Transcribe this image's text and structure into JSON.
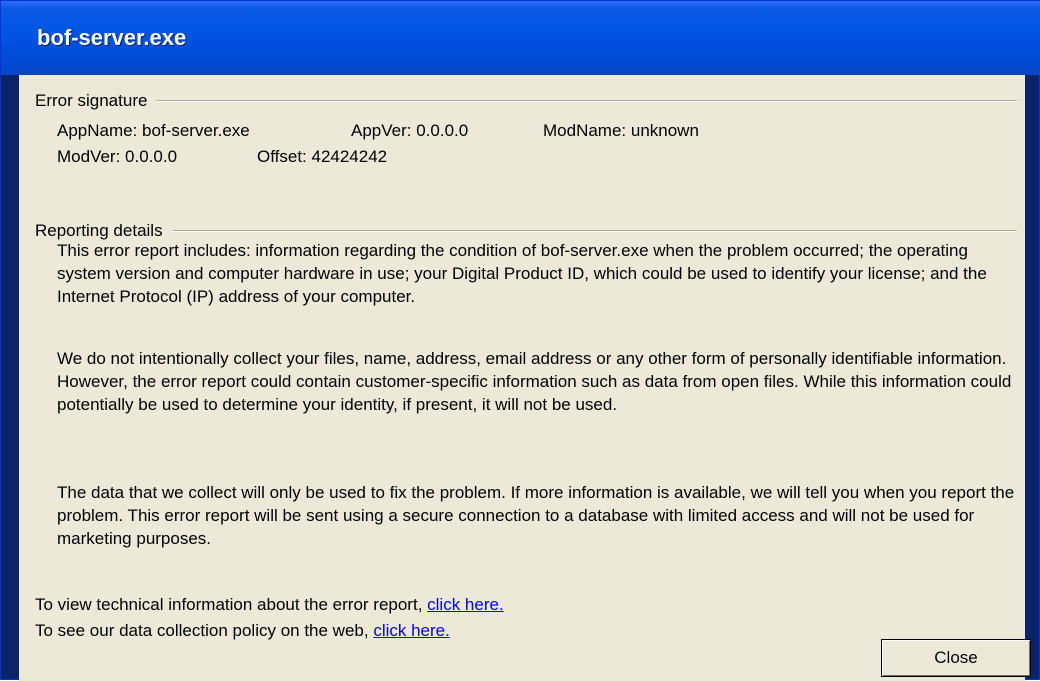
{
  "window": {
    "title": "bof-server.exe"
  },
  "error_signature": {
    "heading": "Error signature",
    "app_name": "AppName: bof-server.exe",
    "app_ver": "AppVer: 0.0.0.0",
    "mod_name": "ModName: unknown",
    "mod_ver": "ModVer: 0.0.0.0",
    "offset": "Offset: 42424242"
  },
  "reporting_details": {
    "heading": "Reporting details",
    "paragraphs": [
      "This error report includes: information regarding the condition of bof-server.exe when the problem occurred; the operating system version and computer hardware in use; your Digital Product ID, which could be used to identify your license; and the Internet Protocol (IP) address of your computer.",
      "We do not intentionally collect your files, name, address, email address or any other form of personally identifiable information. However, the error report could contain customer-specific information such as data from open files. While this information could potentially be used to determine your identity, if present, it will not be used.",
      "The data that we collect will only be used to fix the problem. If more information is available, we will tell you when you report the problem. This error report will be sent using a secure connection to a database with limited access and will not be used for marketing purposes."
    ]
  },
  "links": {
    "technical_text": "To view technical information about the error report,",
    "technical_link": "click here.",
    "policy_text": "To see our data collection policy on the web,",
    "policy_link": "click here."
  },
  "buttons": {
    "close_label": "Close"
  },
  "colors": {
    "titlebar": "#0054e3",
    "dialog_bg": "#ece9d8",
    "link": "#0000ff"
  }
}
